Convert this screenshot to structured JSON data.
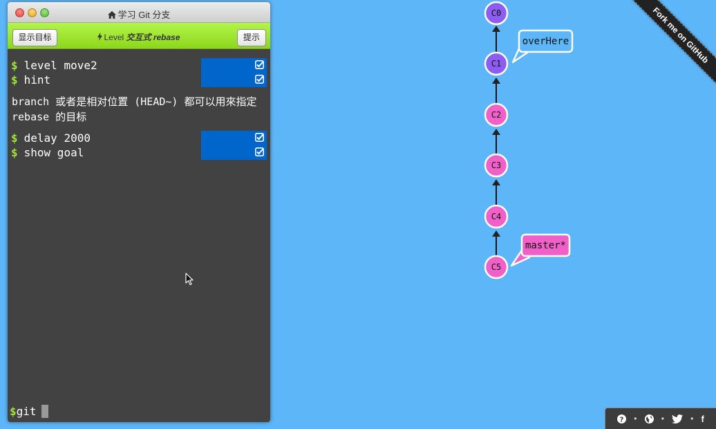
{
  "window": {
    "title": "学习 Git 分支",
    "show_goal_button": "显示目标",
    "hint_button": "提示",
    "level_prefix": "Level",
    "level_name": "交互式 rebase"
  },
  "terminal": {
    "commands_top": [
      "level move2",
      "hint"
    ],
    "hint_text": "branch 或者是相对位置 (HEAD~) 都可以用來指定 rebase 的目标",
    "commands_bottom": [
      "delay 2000",
      "show goal"
    ],
    "prompt": "git"
  },
  "tree": {
    "commits": [
      {
        "id": "C0",
        "color": "#8d5cf1"
      },
      {
        "id": "C1",
        "color": "#8d5cf1"
      },
      {
        "id": "C2",
        "color": "#f060c8"
      },
      {
        "id": "C3",
        "color": "#f060c8"
      },
      {
        "id": "C4",
        "color": "#f060c8"
      },
      {
        "id": "C5",
        "color": "#f060c8"
      }
    ],
    "branches": [
      {
        "name": "overHere",
        "target": "C1",
        "color": "#5cb6f8"
      },
      {
        "name": "master*",
        "target": "C5",
        "color": "#f060c8"
      }
    ]
  },
  "github_ribbon": "Fork me on GitHub",
  "footer": {
    "icons": [
      "help-icon",
      "globe-icon",
      "twitter-icon",
      "facebook-icon"
    ],
    "separator": "•",
    "facebook_label": "f"
  },
  "colors": {
    "background": "#5cb6f8",
    "terminal_bg": "#424242",
    "level_bar": "#9ce538",
    "dollar": "#9ce538",
    "command_highlight": "#0066cc"
  }
}
